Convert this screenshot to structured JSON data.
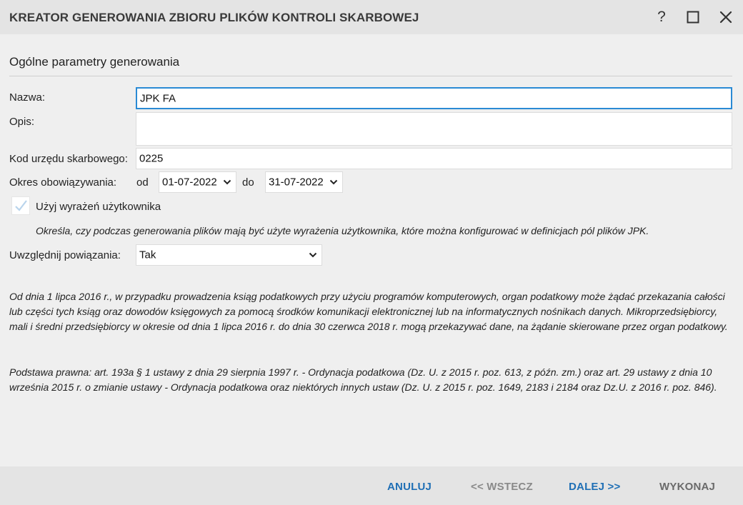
{
  "window": {
    "title": "KREATOR GENEROWANIA ZBIORU PLIKÓW KONTROLI SKARBOWEJ",
    "help_glyph": "?",
    "icons": [
      "help-icon",
      "maximize-icon",
      "close-icon"
    ]
  },
  "section": {
    "title": "Ogólne parametry generowania"
  },
  "form": {
    "name_label": "Nazwa:",
    "name_value": "JPK FA",
    "description_label": "Opis:",
    "description_value": "",
    "tax_office_label": "Kod urzędu skarbowego:",
    "tax_office_value": "0225",
    "period_label": "Okres obowiązywania:",
    "from_label": "od",
    "from_value": "01-07-2022",
    "to_label": "do",
    "to_value": "31-07-2022",
    "user_expr_label": "Użyj wyrażeń użytkownika",
    "user_expr_checked": true,
    "user_expr_hint": "Określa, czy podczas generowania plików mają być użyte wyrażenia użytkownika, które można konfigurować w definicjach pól plików JPK.",
    "relations_label": "Uwzględnij powiązania:",
    "relations_value": "Tak"
  },
  "notes": {
    "paragraph1": "Od dnia 1 lipca 2016 r., w przypadku prowadzenia ksiąg podatkowych przy użyciu programów komputerowych, organ podatkowy może żądać przekazania całości lub części tych ksiąg oraz dowodów księgowych za pomocą środków komunikacji elektronicznej lub na informatycznych nośnikach danych. Mikroprzedsiębiorcy, mali i średni przedsiębiorcy w okresie od dnia 1 lipca 2016 r. do dnia 30 czerwca 2018 r. mogą przekazywać dane, na żądanie skierowane przez organ podatkowy.",
    "paragraph2": "Podstawa prawna: art. 193a § 1 ustawy z dnia 29 sierpnia 1997 r. - Ordynacja podatkowa (Dz. U. z 2015 r. poz. 613, z późn. zm.) oraz art. 29 ustawy z dnia 10 września 2015 r. o zmianie ustawy - Ordynacja podatkowa oraz niektórych innych ustaw (Dz. U. z 2015 r. poz. 1649, 2183 i 2184 oraz Dz.U. z 2016 r. poz. 846)."
  },
  "footer": {
    "cancel": "ANULUJ",
    "back": "<< WSTECZ",
    "next": "DALEJ >>",
    "execute": "WYKONAJ"
  },
  "colors": {
    "accent": "#1f6fb5",
    "focus_border": "#2a8ad4",
    "disabled": "#8a8a8a",
    "background": "#efefef",
    "bar": "#e4e4e4"
  }
}
